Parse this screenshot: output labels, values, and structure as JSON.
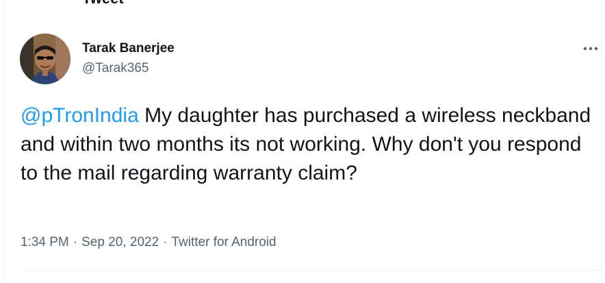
{
  "header": {
    "title": "Tweet"
  },
  "author": {
    "name": "Tarak Banerjee",
    "handle": "@Tarak365"
  },
  "tweet": {
    "mention": "@pTronIndia",
    "body": " My daughter has purchased a wireless neckband and within two months its not working. Why don't you respond to the mail regarding warranty claim?"
  },
  "meta": {
    "time": "1:34 PM",
    "date": "Sep 20, 2022",
    "source": "Twitter for Android",
    "separator": "·"
  },
  "icons": {
    "more": "more-horizontal-icon"
  },
  "colors": {
    "accent": "#1d9bf0",
    "text_primary": "#0f1419",
    "text_secondary": "#536471",
    "border": "#eff3f4"
  }
}
